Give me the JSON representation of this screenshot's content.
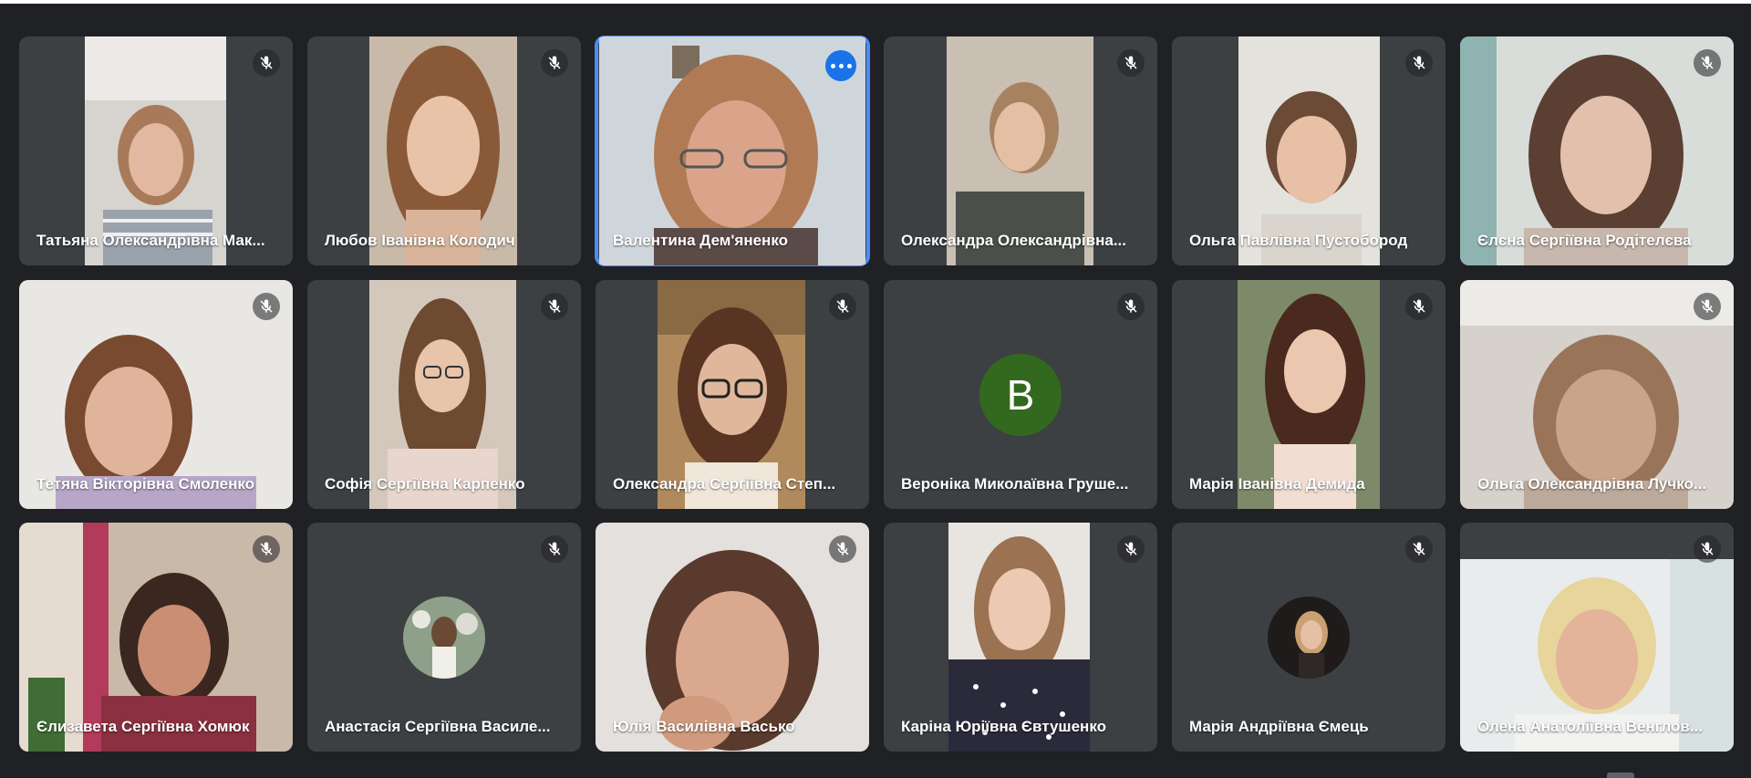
{
  "app": "Google Meet",
  "layout": "tiled",
  "colors": {
    "background": "#202124",
    "tile": "#3c4043",
    "active_outline": "#4c8bf5",
    "more_button": "#1a73e8",
    "letter_avatar": "#33691e"
  },
  "participants": [
    {
      "name": "Татьяна Олександрівна Мак...",
      "muted": true
    },
    {
      "name": "Любов Іванівна Колодич",
      "muted": true
    },
    {
      "name": "Валентина Дем'яненко",
      "muted": false,
      "active": true
    },
    {
      "name": "Олександра Олександрівна...",
      "muted": true
    },
    {
      "name": "Ольга Павлівна Пустобород",
      "muted": true
    },
    {
      "name": "Єлєна Сергіївна Родітелєва",
      "muted": true
    },
    {
      "name": "Тетяна Вікторівна Смоленко",
      "muted": true
    },
    {
      "name": "Софія Сергіївна Карпенко",
      "muted": true
    },
    {
      "name": "Олександра Сергіївна Степ...",
      "muted": true
    },
    {
      "name": "Вероніка Миколаївна Груше...",
      "muted": true,
      "avatar_letter": "В"
    },
    {
      "name": "Марія Іванівна Демида",
      "muted": true
    },
    {
      "name": "Ольга Олександрівна Лучко...",
      "muted": true
    },
    {
      "name": "Єлизавета Сергіївна Хомюк",
      "muted": true
    },
    {
      "name": "Анастасія Сергіївна Василе...",
      "muted": true
    },
    {
      "name": "Юлія Василівна Васько",
      "muted": true
    },
    {
      "name": "Каріна Юріївна Євтушенко",
      "muted": true
    },
    {
      "name": "Марія Андріївна Ємець",
      "muted": true
    },
    {
      "name": "Олена Анатоліївна Венглов...",
      "muted": true
    }
  ],
  "icons": {
    "muted": "mic-off-icon",
    "more": "more-options-icon"
  }
}
